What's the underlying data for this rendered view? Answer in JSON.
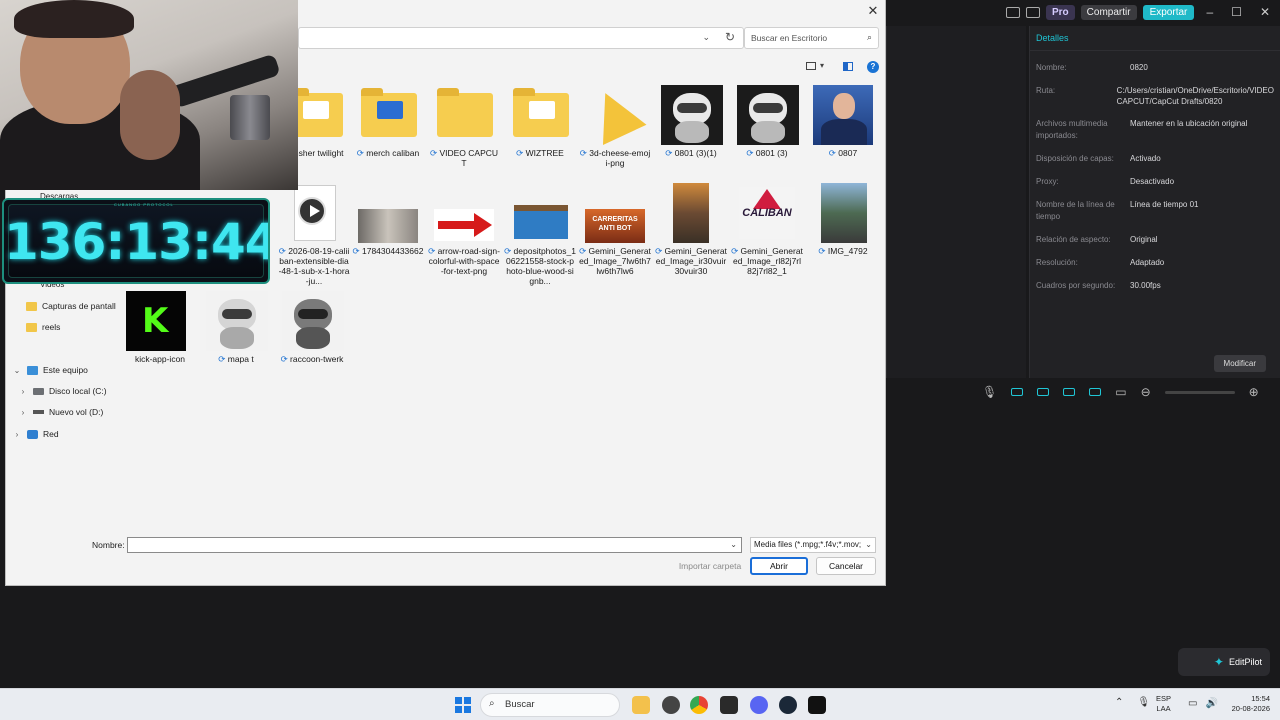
{
  "capcut": {
    "pro_label": "Pro",
    "share_label": "Compartir",
    "export_label": "Exportar",
    "details_title": "Detalles",
    "details": [
      {
        "key": "Nombre:",
        "value": "0820"
      },
      {
        "key": "Ruta:",
        "value": "C:/Users/cristian/OneDrive/Escritorio/VIDEO CAPCUT/CapCut Drafts/0820"
      },
      {
        "key": "Archivos multimedia importados:",
        "value": "Mantener en la ubicación original"
      },
      {
        "key": "Disposición de capas:",
        "value": "Activado"
      },
      {
        "key": "Proxy:",
        "value": "Desactivado"
      },
      {
        "key": "Nombre de la línea de tiempo",
        "value": "Línea de tiempo 01"
      },
      {
        "key": "Relación de aspecto:",
        "value": "Original"
      },
      {
        "key": "Resolución:",
        "value": "Adaptado"
      },
      {
        "key": "Cuadros por segundo:",
        "value": "30.00fps"
      }
    ],
    "modify_label": "Modificar",
    "editpilot_label": "EditPilot"
  },
  "timer": {
    "label": "CUBANGO PROTOCOL",
    "value": "136:13:44"
  },
  "dialog": {
    "search_placeholder": "Buscar en Escritorio",
    "nav": [
      {
        "label": "Descargas"
      },
      {
        "label": "Videos"
      },
      {
        "label": "Capturas de pantall"
      },
      {
        "label": "reels"
      },
      {
        "label": "Este equipo"
      },
      {
        "label": "Disco local (C:)"
      },
      {
        "label": "Nuevo vol (D:)"
      },
      {
        "label": "Red"
      }
    ],
    "files_row1": [
      {
        "name": "Lunsher twilight",
        "sync": ""
      },
      {
        "name": "merch caliban",
        "sync": "⟳ "
      },
      {
        "name": "VIDEO CAPCUT",
        "sync": "⟳ "
      },
      {
        "name": "WIZTREE",
        "sync": "⟳ "
      },
      {
        "name": "3d-cheese-emoji-png",
        "sync": "⟳ "
      },
      {
        "name": "0801 (3)(1)",
        "sync": "⟳ "
      },
      {
        "name": "0801 (3)",
        "sync": "⟳ "
      },
      {
        "name": "0807",
        "sync": "⟳ "
      }
    ],
    "files_row2": [
      {
        "name": "2026-08-19-caliiban-extensible-dia-48-1-sub-x-1-hora-ju...",
        "sync": "⟳ "
      },
      {
        "name": "1784304433662",
        "sync": "⟳ "
      },
      {
        "name": "arrow-road-sign-colorful-with-space-for-text-png",
        "sync": "⟳ "
      },
      {
        "name": "depositphotos_106221558-stock-photo-blue-wood-signb...",
        "sync": "⟳ "
      },
      {
        "name": "Gemini_Generated_Image_7lw6th7lw6th7lw6",
        "sync": "⟳ "
      },
      {
        "name": "Gemini_Generated_Image_ir30vuir30vuir30",
        "sync": "⟳ "
      },
      {
        "name": "Gemini_Generated_Image_rl82j7rl82j7rl82_1",
        "sync": "⟳ "
      },
      {
        "name": "IMG_4792",
        "sync": "⟳ "
      }
    ],
    "files_row3": [
      {
        "name": "kick-app-icon",
        "sync": ""
      },
      {
        "name": "mapa t",
        "sync": "⟳ "
      },
      {
        "name": "raccoon-twerk",
        "sync": "⟳ "
      }
    ],
    "thumb_texts": {
      "banner": "CARRERITAS ANTI BOT",
      "caliban": "CALIBAN",
      "kick": "K"
    },
    "name_label": "Nombre:",
    "name_value": "",
    "filter_value": "Media files (*.mpg;*.f4v;*.mov;",
    "import_folder_label": "Importar carpeta",
    "open_label": "Abrir",
    "cancel_label": "Cancelar"
  },
  "taskbar": {
    "search_label": "Buscar",
    "lang_line1": "ESP",
    "lang_line2": "LAA",
    "time": "15:54",
    "date": "20-08-2026"
  }
}
